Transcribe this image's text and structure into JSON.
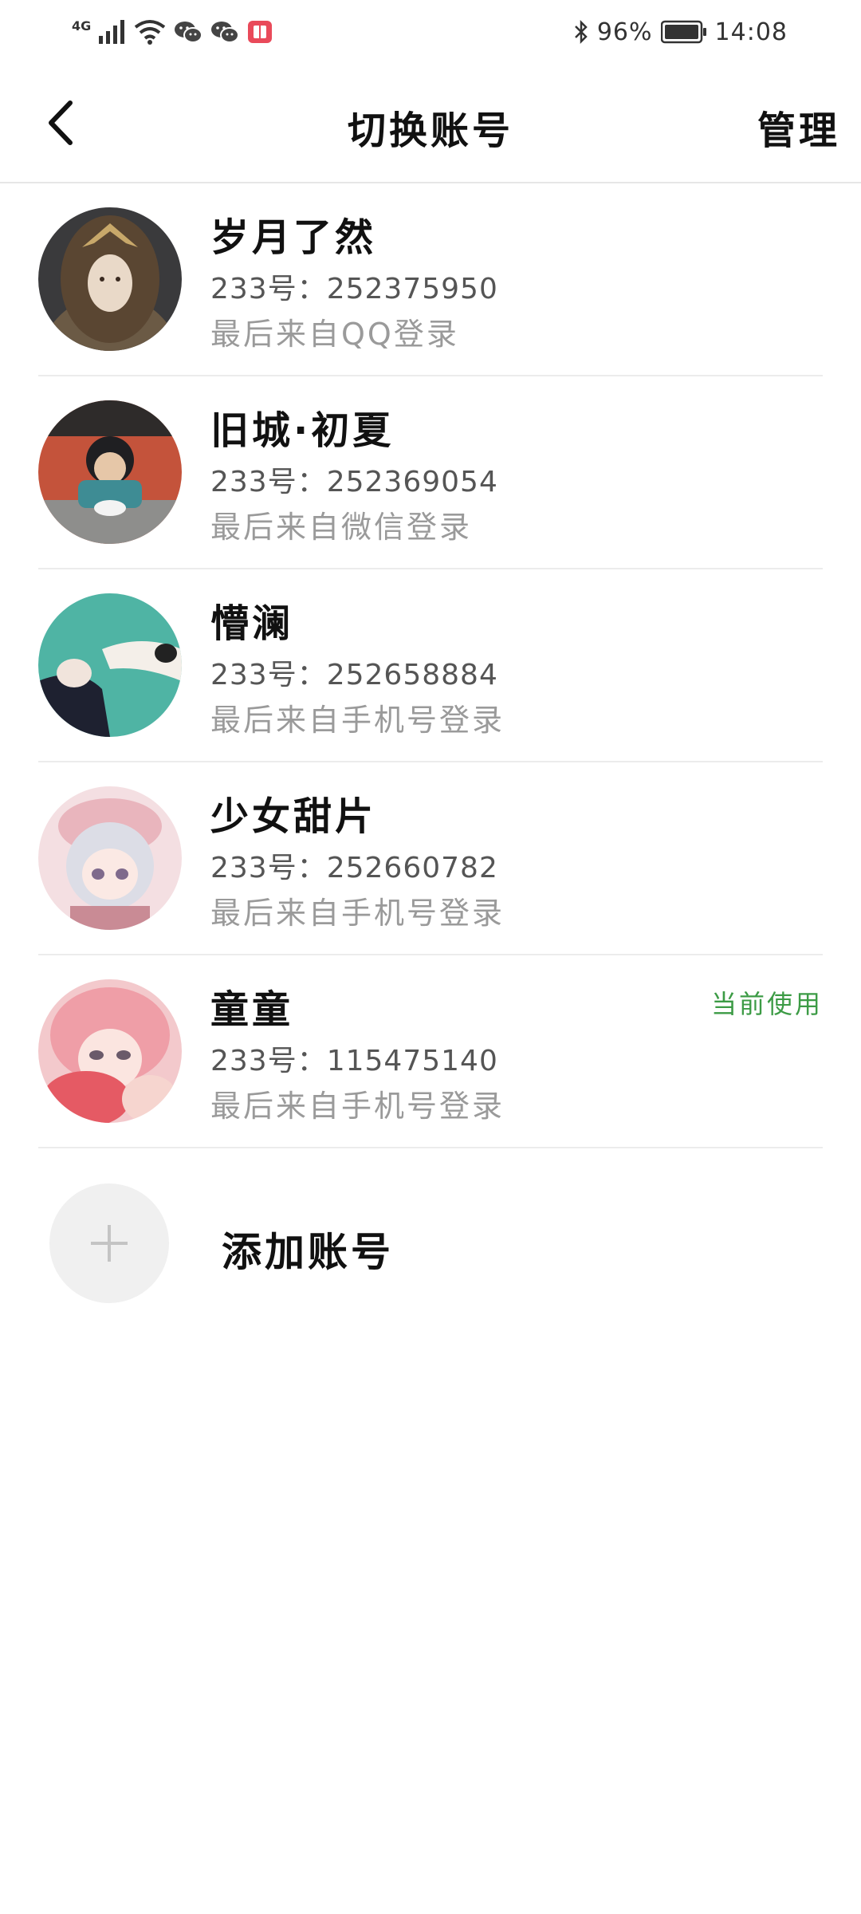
{
  "status_bar": {
    "network": "4G",
    "battery": "96%",
    "time": "14:08",
    "icons": [
      "signal-icon",
      "wifi-icon",
      "wechat-icon",
      "wechat-icon",
      "notification-app-icon",
      "bluetooth-icon",
      "battery-icon"
    ]
  },
  "header": {
    "title": "切换账号",
    "manage_label": "管理",
    "back_icon": "chevron-left-icon"
  },
  "accounts": [
    {
      "name": "岁月了然",
      "id": "233号：252375950",
      "login": "最后来自QQ登录",
      "current": ""
    },
    {
      "name": "旧城·初夏",
      "id": "233号：252369054",
      "login": "最后来自微信登录",
      "current": ""
    },
    {
      "name": "懵澜",
      "id": "233号：252658884",
      "login": "最后来自手机号登录",
      "current": ""
    },
    {
      "name": "少女甜片",
      "id": "233号：252660782",
      "login": "最后来自手机号登录",
      "current": ""
    },
    {
      "name": "童童",
      "id": "233号：115475140",
      "login": "最后来自手机号登录",
      "current": "当前使用"
    }
  ],
  "add_account": {
    "label": "添加账号",
    "icon": "plus-icon"
  },
  "colors": {
    "current_badge": "#3c9b45",
    "secondary_text": "#9a9a9a",
    "divider": "#ececec"
  }
}
